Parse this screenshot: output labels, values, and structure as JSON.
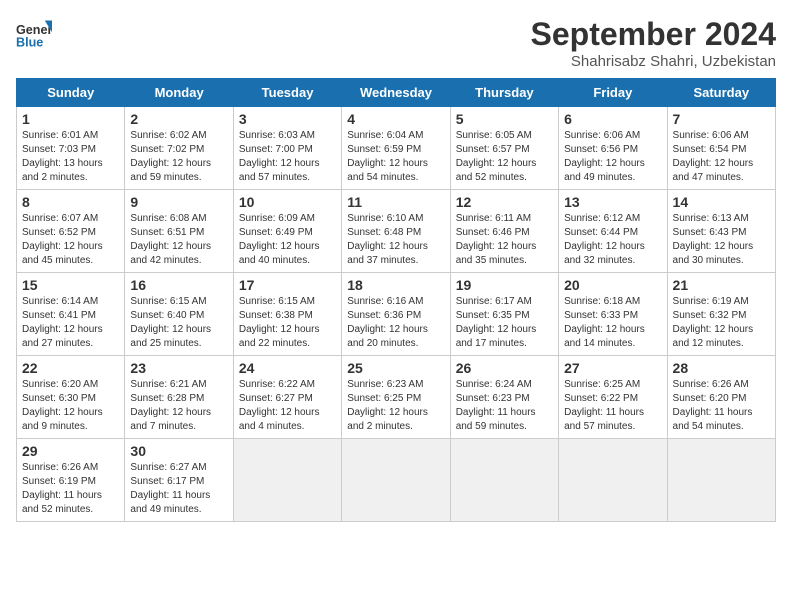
{
  "header": {
    "logo_line1": "General",
    "logo_line2": "Blue",
    "month": "September 2024",
    "location": "Shahrisabz Shahri, Uzbekistan"
  },
  "weekdays": [
    "Sunday",
    "Monday",
    "Tuesday",
    "Wednesday",
    "Thursday",
    "Friday",
    "Saturday"
  ],
  "weeks": [
    [
      {
        "day": "1",
        "info": "Sunrise: 6:01 AM\nSunset: 7:03 PM\nDaylight: 13 hours\nand 2 minutes."
      },
      {
        "day": "2",
        "info": "Sunrise: 6:02 AM\nSunset: 7:02 PM\nDaylight: 12 hours\nand 59 minutes."
      },
      {
        "day": "3",
        "info": "Sunrise: 6:03 AM\nSunset: 7:00 PM\nDaylight: 12 hours\nand 57 minutes."
      },
      {
        "day": "4",
        "info": "Sunrise: 6:04 AM\nSunset: 6:59 PM\nDaylight: 12 hours\nand 54 minutes."
      },
      {
        "day": "5",
        "info": "Sunrise: 6:05 AM\nSunset: 6:57 PM\nDaylight: 12 hours\nand 52 minutes."
      },
      {
        "day": "6",
        "info": "Sunrise: 6:06 AM\nSunset: 6:56 PM\nDaylight: 12 hours\nand 49 minutes."
      },
      {
        "day": "7",
        "info": "Sunrise: 6:06 AM\nSunset: 6:54 PM\nDaylight: 12 hours\nand 47 minutes."
      }
    ],
    [
      {
        "day": "8",
        "info": "Sunrise: 6:07 AM\nSunset: 6:52 PM\nDaylight: 12 hours\nand 45 minutes."
      },
      {
        "day": "9",
        "info": "Sunrise: 6:08 AM\nSunset: 6:51 PM\nDaylight: 12 hours\nand 42 minutes."
      },
      {
        "day": "10",
        "info": "Sunrise: 6:09 AM\nSunset: 6:49 PM\nDaylight: 12 hours\nand 40 minutes."
      },
      {
        "day": "11",
        "info": "Sunrise: 6:10 AM\nSunset: 6:48 PM\nDaylight: 12 hours\nand 37 minutes."
      },
      {
        "day": "12",
        "info": "Sunrise: 6:11 AM\nSunset: 6:46 PM\nDaylight: 12 hours\nand 35 minutes."
      },
      {
        "day": "13",
        "info": "Sunrise: 6:12 AM\nSunset: 6:44 PM\nDaylight: 12 hours\nand 32 minutes."
      },
      {
        "day": "14",
        "info": "Sunrise: 6:13 AM\nSunset: 6:43 PM\nDaylight: 12 hours\nand 30 minutes."
      }
    ],
    [
      {
        "day": "15",
        "info": "Sunrise: 6:14 AM\nSunset: 6:41 PM\nDaylight: 12 hours\nand 27 minutes."
      },
      {
        "day": "16",
        "info": "Sunrise: 6:15 AM\nSunset: 6:40 PM\nDaylight: 12 hours\nand 25 minutes."
      },
      {
        "day": "17",
        "info": "Sunrise: 6:15 AM\nSunset: 6:38 PM\nDaylight: 12 hours\nand 22 minutes."
      },
      {
        "day": "18",
        "info": "Sunrise: 6:16 AM\nSunset: 6:36 PM\nDaylight: 12 hours\nand 20 minutes."
      },
      {
        "day": "19",
        "info": "Sunrise: 6:17 AM\nSunset: 6:35 PM\nDaylight: 12 hours\nand 17 minutes."
      },
      {
        "day": "20",
        "info": "Sunrise: 6:18 AM\nSunset: 6:33 PM\nDaylight: 12 hours\nand 14 minutes."
      },
      {
        "day": "21",
        "info": "Sunrise: 6:19 AM\nSunset: 6:32 PM\nDaylight: 12 hours\nand 12 minutes."
      }
    ],
    [
      {
        "day": "22",
        "info": "Sunrise: 6:20 AM\nSunset: 6:30 PM\nDaylight: 12 hours\nand 9 minutes."
      },
      {
        "day": "23",
        "info": "Sunrise: 6:21 AM\nSunset: 6:28 PM\nDaylight: 12 hours\nand 7 minutes."
      },
      {
        "day": "24",
        "info": "Sunrise: 6:22 AM\nSunset: 6:27 PM\nDaylight: 12 hours\nand 4 minutes."
      },
      {
        "day": "25",
        "info": "Sunrise: 6:23 AM\nSunset: 6:25 PM\nDaylight: 12 hours\nand 2 minutes."
      },
      {
        "day": "26",
        "info": "Sunrise: 6:24 AM\nSunset: 6:23 PM\nDaylight: 11 hours\nand 59 minutes."
      },
      {
        "day": "27",
        "info": "Sunrise: 6:25 AM\nSunset: 6:22 PM\nDaylight: 11 hours\nand 57 minutes."
      },
      {
        "day": "28",
        "info": "Sunrise: 6:26 AM\nSunset: 6:20 PM\nDaylight: 11 hours\nand 54 minutes."
      }
    ],
    [
      {
        "day": "29",
        "info": "Sunrise: 6:26 AM\nSunset: 6:19 PM\nDaylight: 11 hours\nand 52 minutes."
      },
      {
        "day": "30",
        "info": "Sunrise: 6:27 AM\nSunset: 6:17 PM\nDaylight: 11 hours\nand 49 minutes."
      },
      null,
      null,
      null,
      null,
      null
    ]
  ]
}
